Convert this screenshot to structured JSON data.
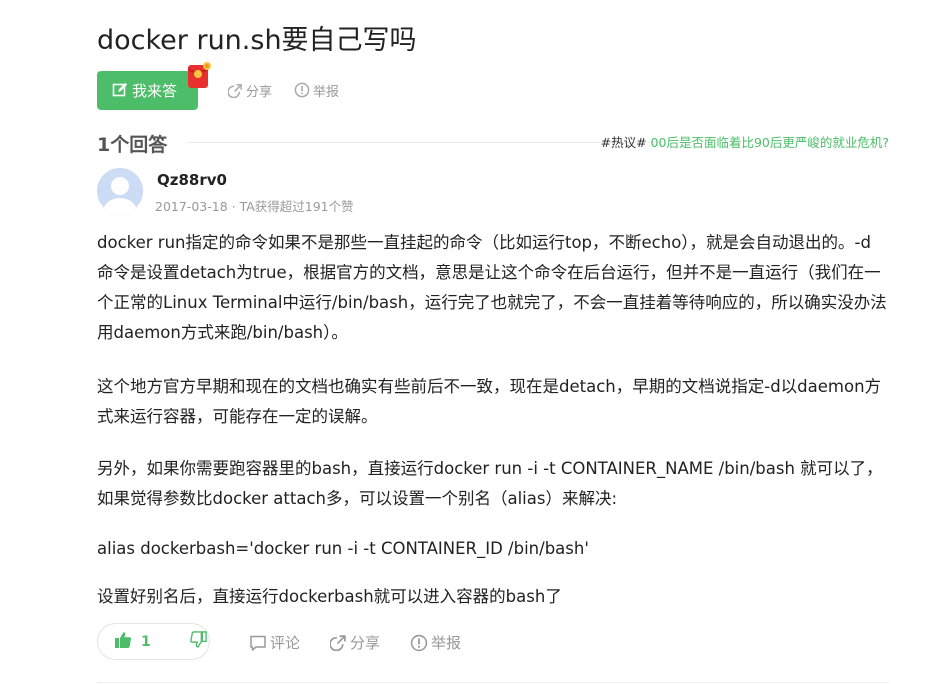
{
  "question": {
    "title": "docker run.sh要自己写吗"
  },
  "actions": {
    "answer_label": "我来答",
    "share_label": "分享",
    "report_label": "举报"
  },
  "answers_header": {
    "count_label": "1个回答",
    "hot_tag": "#热议#",
    "hot_link": "00后是否面临着比90后更严峻的就业危机?"
  },
  "answer": {
    "author": "Qz88rv0",
    "meta": "2017-03-18 · TA获得超过191个赞",
    "paragraphs": [
      "docker run指定的命令如果不是那些一直挂起的命令（比如运行top，不断echo），就是会自动退出的。-d命令是设置detach为true，根据官方的文档，意思是让这个命令在后台运行，但并不是一直运行（我们在一个正常的Linux Terminal中运行/bin/bash，运行完了也就完了，不会一直挂着等待响应的，所以确实没办法用daemon方式来跑/bin/bash）。",
      "这个地方官方早期和现在的文档也确实有些前后不一致，现在是detach，早期的文档说指定-d以daemon方式来运行容器，可能存在一定的误解。",
      "另外，如果你需要跑容器里的bash，直接运行docker run -i -t CONTAINER_NAME /bin/bash 就可以了，如果觉得参数比docker attach多，可以设置一个别名（alias）来解决:",
      "alias dockerbash='docker run -i -t CONTAINER_ID /bin/bash'",
      "设置好别名后，直接运行dockerbash就可以进入容器的bash了"
    ],
    "upvotes": "1",
    "comment_label": "评论",
    "share_label": "分享",
    "report_label": "举报"
  },
  "colors": {
    "accent": "#4dbd6a",
    "muted": "#999999",
    "text": "#222222"
  },
  "icons": [
    "edit-icon",
    "red-envelope-icon",
    "share-icon",
    "report-icon",
    "thumb-up-icon",
    "thumb-down-icon",
    "comment-icon",
    "avatar-placeholder"
  ]
}
